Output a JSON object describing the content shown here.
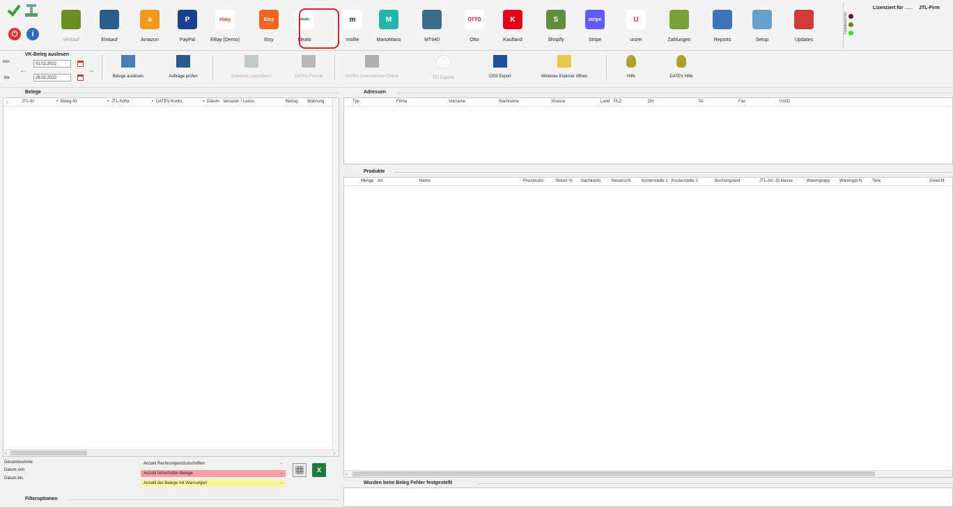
{
  "ribbon": {
    "items": [
      {
        "label": "Verkauf",
        "icon": "basket-icon",
        "color": "#6b8e23",
        "disabled": true
      },
      {
        "label": "Einkauf",
        "icon": "warehouse-icon",
        "color": "#2b5d8a"
      },
      {
        "label": "Amazon",
        "icon": "amazon-icon",
        "color": "#f39a1d",
        "glyph": "a"
      },
      {
        "label": "PayPal",
        "icon": "paypal-icon",
        "color": "#1f3f8f",
        "glyph": "P"
      },
      {
        "label": "EBay (Demo)",
        "icon": "ebay-icon",
        "color": "#ffffff",
        "glyph": "ebay"
      },
      {
        "label": "Etsy",
        "icon": "etsy-icon",
        "color": "#f16521",
        "glyph": "Etsy"
      },
      {
        "label": "Idealo",
        "icon": "idealo-icon",
        "color": "#ffffff",
        "glyph": "idealo"
      },
      {
        "label": "mollie",
        "icon": "mollie-icon",
        "color": "#ffffff",
        "glyph": "m"
      },
      {
        "label": "ManoMano",
        "icon": "manomano-icon",
        "color": "#24b5a8",
        "glyph": "M"
      },
      {
        "label": "MT940",
        "icon": "bank-icon",
        "color": "#3a6e88"
      },
      {
        "label": "Otto",
        "icon": "otto-icon",
        "color": "#ffffff",
        "glyph": "OTTO"
      },
      {
        "label": "Kaufland",
        "icon": "kaufland-icon",
        "color": "#e2001a",
        "glyph": "K"
      },
      {
        "label": "Shopify",
        "icon": "shopify-icon",
        "color": "#5e8e3e",
        "glyph": "S"
      },
      {
        "label": "Stripe",
        "icon": "stripe-icon",
        "color": "#635bff",
        "glyph": "stripe"
      },
      {
        "label": "unzer",
        "icon": "unzer-icon",
        "color": "#ffffff",
        "glyph": "U"
      },
      {
        "label": "Zahlungen",
        "icon": "money-icon",
        "color": "#7aa23a"
      },
      {
        "label": "Reports",
        "icon": "reports-icon",
        "color": "#3c74b8"
      },
      {
        "label": "Setup",
        "icon": "setup-icon",
        "color": "#6aa0c8"
      },
      {
        "label": "Updates",
        "icon": "updates-icon",
        "color": "#d03a3a"
      }
    ],
    "license_label": "Lizenziert für",
    "license_value": "JTL-Firm",
    "status_vertical": "Updateservice"
  },
  "toolbar": {
    "vk_title": "VK-Beleg auslesen",
    "von_label": "von",
    "bis_label": "bis",
    "date_from": "01.02.2022",
    "date_to": "28.02.2022",
    "buttons": [
      {
        "label": "Belege auslesen",
        "icon": "gears-icon",
        "disabled": false
      },
      {
        "label": "Aufträge prüfen",
        "icon": "check-cart-icon",
        "disabled": false
      },
      {
        "label": "Debitoren exportieren",
        "icon": "export-cart-icon",
        "disabled": true
      },
      {
        "label": "DATEV Format",
        "icon": "datev-format-icon",
        "disabled": true
      },
      {
        "label": "DATEV Unternehmen Online",
        "icon": "datev-online-icon",
        "disabled": true
      },
      {
        "label": "EU Exports",
        "icon": "eu-stars-icon",
        "disabled": true
      },
      {
        "label": "OSS Export",
        "icon": "oss-icon",
        "disabled": false
      },
      {
        "label": "Windows Explorer öffnen",
        "icon": "folder-icon",
        "disabled": false
      },
      {
        "label": "Hilfe",
        "icon": "help-icon",
        "disabled": false
      },
      {
        "label": "DATEV Hilfe",
        "icon": "datev-help-icon",
        "disabled": false
      }
    ]
  },
  "belege": {
    "title": "Belege",
    "columns": [
      "JTL-ID",
      "Beleg-Nr.",
      "JTL-KdNr.",
      "DATEV-Konto",
      "Datum",
      "Versand- / Leistu",
      "Betrag",
      "Währung"
    ]
  },
  "adressen": {
    "title": "Adressen",
    "columns": [
      "Typ",
      "Firma",
      "Vorname",
      "Nachname",
      "Strasse",
      "Land",
      "PLZ",
      "Ort",
      "Tel",
      "Fax",
      "UstID"
    ]
  },
  "produkte": {
    "title": "Produkte",
    "columns": [
      "Menge",
      "Art",
      "Name",
      "Preisbrutto",
      "Steuer %",
      "Sachkonto",
      "Steuerschl.",
      "Kostenstelle 1",
      "Kostenstelle 2",
      "Buchungstext",
      "JTL-Art.-St.klasse",
      "Warengrupp",
      "Warengrp-N",
      "Taric",
      "Gewicht"
    ]
  },
  "summary": {
    "gesamtsumme": "Gesamtsumme",
    "datum_von": "Datum von",
    "datum_bis": "Datum bis",
    "anzahl_rechnungen": "Anzahl Rechnungen/Gutschriften",
    "anzahl_fehler": "Anzahl fehlerhafter Belege",
    "anzahl_warnungen": "Anzahl der Belege mit Warnungen",
    "dash": "-",
    "error_color": "#f4a0a4",
    "warn_color": "#fbf59a"
  },
  "fehler_title": "Wurden beim Beleg Fehler festgestellt",
  "filter_title": "Filteroptionen"
}
